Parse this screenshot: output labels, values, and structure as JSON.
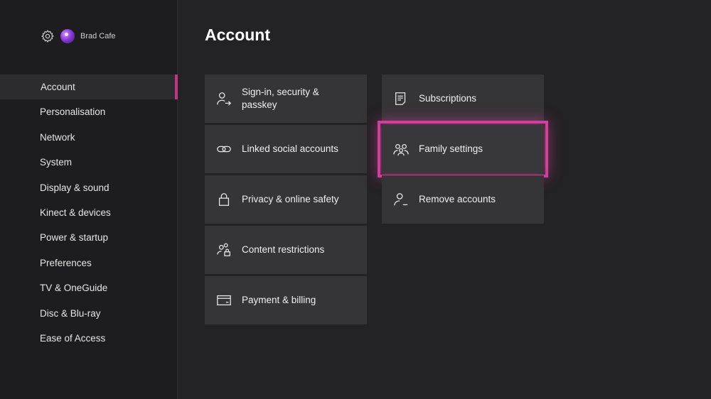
{
  "profile": {
    "gamertag": "Brad Cafe",
    "icons": [
      "gear-icon",
      "avatar"
    ]
  },
  "sidebar": {
    "items": [
      {
        "label": "Account",
        "active": true
      },
      {
        "label": "Personalisation"
      },
      {
        "label": "Network"
      },
      {
        "label": "System"
      },
      {
        "label": "Display & sound"
      },
      {
        "label": "Kinect & devices"
      },
      {
        "label": "Power & startup"
      },
      {
        "label": "Preferences"
      },
      {
        "label": "TV & OneGuide"
      },
      {
        "label": "Disc & Blu-ray"
      },
      {
        "label": "Ease of Access"
      }
    ]
  },
  "main": {
    "title": "Account",
    "tiles_left": [
      {
        "label": "Sign-in, security & passkey",
        "icon": "person-arrow-icon"
      },
      {
        "label": "Linked social accounts",
        "icon": "link-icon"
      },
      {
        "label": "Privacy & online safety",
        "icon": "lock-icon"
      },
      {
        "label": "Content restrictions",
        "icon": "people-lock-icon"
      },
      {
        "label": "Payment & billing",
        "icon": "credit-card-icon"
      }
    ],
    "tiles_right": [
      {
        "label": "Subscriptions",
        "icon": "document-list-icon"
      },
      {
        "label": "Family settings",
        "icon": "family-icon",
        "focused": true
      },
      {
        "label": "Remove accounts",
        "icon": "person-remove-icon"
      }
    ]
  },
  "colors": {
    "accent": "#d13e9b",
    "sidebar_indicator": "#c13584",
    "background": "#232224",
    "sidebar_bg": "#1d1c1e",
    "tile_bg": "#353437"
  }
}
